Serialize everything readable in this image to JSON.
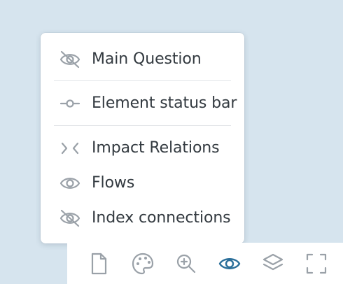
{
  "menu": {
    "items": [
      {
        "label": "Main Question",
        "icon": "eye-off-icon"
      },
      {
        "label": "Element status bar",
        "icon": "commit-slider-icon"
      },
      {
        "label": "Impact Relations",
        "icon": "arrows-converge-icon"
      },
      {
        "label": "Flows",
        "icon": "eye-icon"
      },
      {
        "label": "Index connections",
        "icon": "eye-off-icon"
      }
    ]
  },
  "toolbar": {
    "buttons": [
      {
        "icon": "document-icon"
      },
      {
        "icon": "palette-icon"
      },
      {
        "icon": "zoom-in-icon"
      },
      {
        "icon": "eye-icon",
        "active": true
      },
      {
        "icon": "layers-icon"
      },
      {
        "icon": "fullscreen-icon"
      }
    ]
  },
  "colors": {
    "background": "#d6e4ee",
    "menu_text": "#333a40",
    "icon_gray": "#9aa1a8",
    "active_blue": "#2b6f9a"
  }
}
